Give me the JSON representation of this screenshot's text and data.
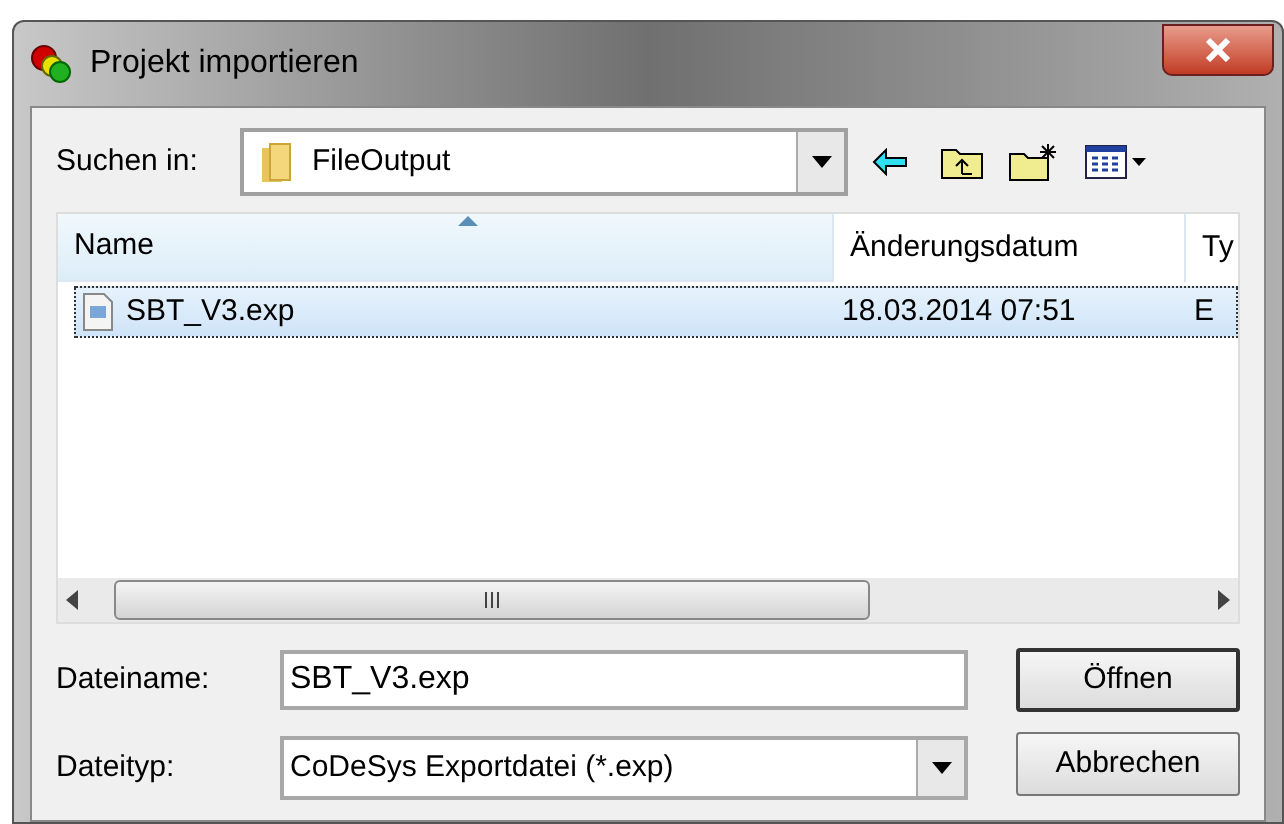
{
  "window": {
    "title": "Projekt importieren"
  },
  "look_in": {
    "label": "Suchen in:",
    "value": "FileOutput"
  },
  "table": {
    "columns": [
      {
        "label": "Name",
        "sorted": true
      },
      {
        "label": "Änderungsdatum",
        "sorted": false
      },
      {
        "label": "Ty",
        "sorted": false
      }
    ],
    "rows": [
      {
        "cells": [
          "SBT_V3.exp",
          "18.03.2014 07:51",
          "E"
        ],
        "selected": true
      }
    ]
  },
  "file_name": {
    "label": "Dateiname:",
    "value": "SBT_V3.exp"
  },
  "file_type": {
    "label": "Dateityp:",
    "value": "CoDeSys Exportdatei (*.exp)"
  },
  "buttons": [
    {
      "label": "Öffnen",
      "default": true
    },
    {
      "label": "Abbrechen",
      "default": false
    }
  ]
}
